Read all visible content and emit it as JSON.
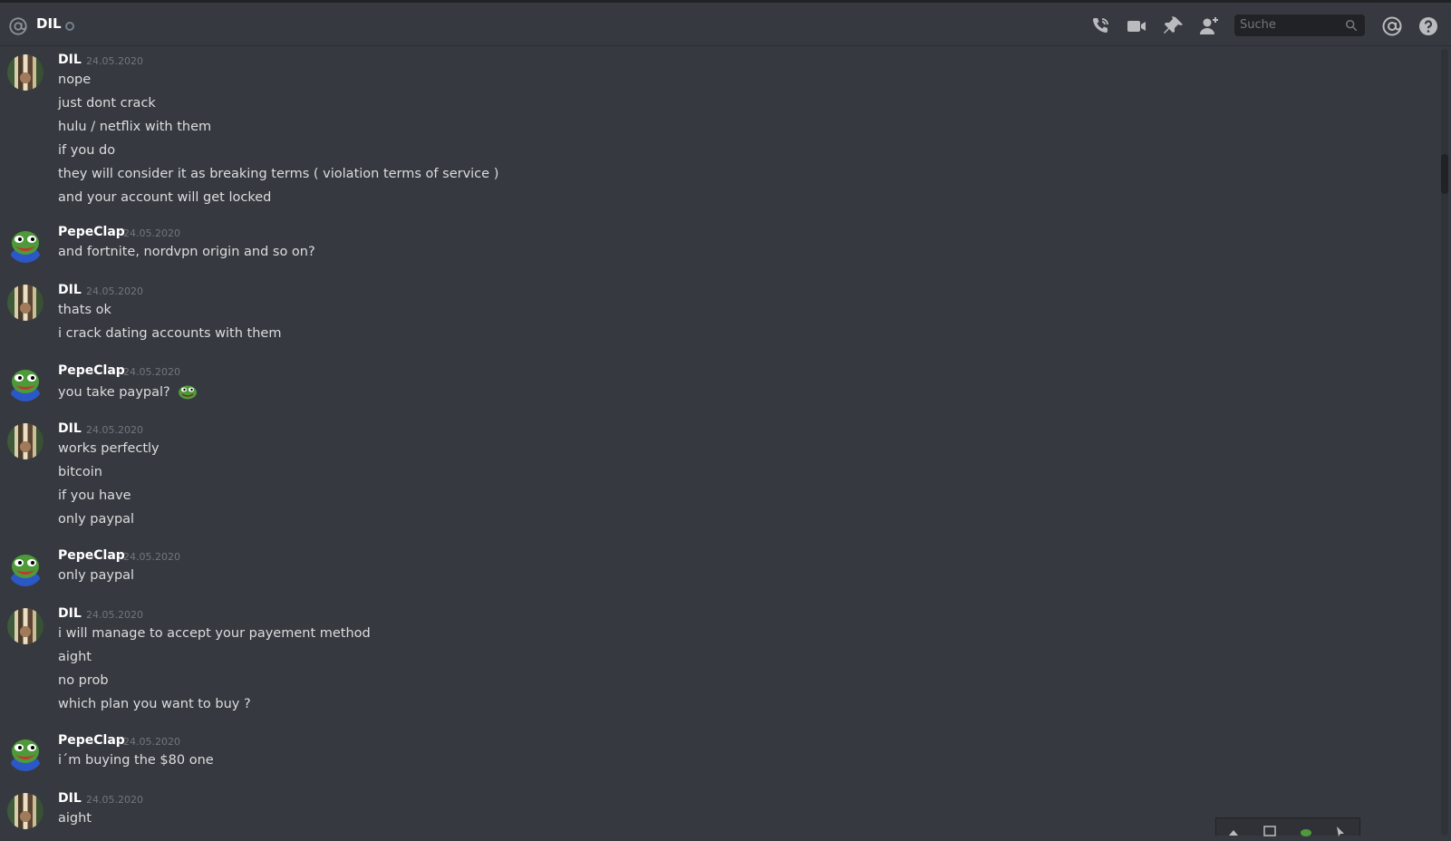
{
  "header": {
    "channel_name": "DIL",
    "status": "offline",
    "search_placeholder": "Suche",
    "icons": [
      "start-voice-call-icon",
      "start-video-call-icon",
      "pinned-messages-icon",
      "add-friend-icon",
      "search-icon",
      "mentions-icon",
      "help-icon"
    ]
  },
  "colors": {
    "background": "#36393f",
    "header_bg": "#36393f",
    "text": "#dcddde",
    "username": "#ffffff",
    "timestamp": "#72767d"
  },
  "messages": [
    {
      "author": "DIL",
      "timestamp": "24.05.2020",
      "lines": [
        "nope",
        "just dont crack",
        "hulu / netflix with them",
        "if you do",
        "they will consider it as breaking terms ( violation terms of service )",
        "and your account will get locked"
      ]
    },
    {
      "author": "PepeClap",
      "timestamp": "24.05.2020",
      "lines": [
        "and fortnite, nordvpn origin and so on?"
      ]
    },
    {
      "author": "DIL",
      "timestamp": "24.05.2020",
      "lines": [
        "thats ok",
        "i crack dating accounts with them"
      ]
    },
    {
      "author": "PepeClap",
      "timestamp": "24.05.2020",
      "lines": [
        "you take paypal?"
      ],
      "emoji": "pepe-emoji"
    },
    {
      "author": "DIL",
      "timestamp": "24.05.2020",
      "lines": [
        "works perfectly",
        "bitcoin",
        "if you have",
        "only paypal"
      ]
    },
    {
      "author": "PepeClap",
      "timestamp": "24.05.2020",
      "lines": [
        "only paypal"
      ]
    },
    {
      "author": "DIL",
      "timestamp": "24.05.2020",
      "lines": [
        "i will manage to accept your payement method",
        "aight",
        "no prob",
        "which plan you want to buy ?"
      ]
    },
    {
      "author": "PepeClap",
      "timestamp": "24.05.2020",
      "lines": [
        "i´m buying the $80 one"
      ]
    },
    {
      "author": "DIL",
      "timestamp": "24.05.2020",
      "lines": [
        "aight"
      ]
    }
  ]
}
